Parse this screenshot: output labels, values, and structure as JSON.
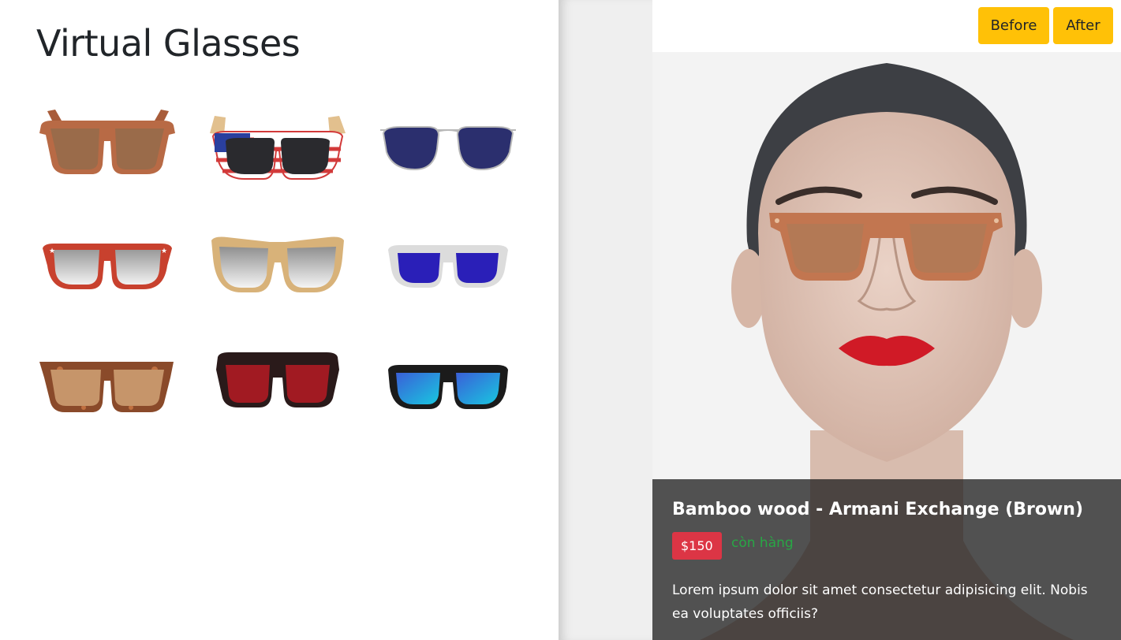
{
  "page": {
    "title": "Virtual Glasses"
  },
  "catalog": {
    "items": [
      {
        "icon": "brown-wood-sunglasses-icon",
        "frame": "#b86a45",
        "lens": "#9a6b4a"
      },
      {
        "icon": "flag-pattern-sunglasses-icon",
        "frame": "#d23a3a",
        "lens": "#2a2a2e"
      },
      {
        "icon": "aviator-sunglasses-icon",
        "frame": "#b8b8b8",
        "lens": "#2b2f6e"
      },
      {
        "icon": "red-star-sunglasses-icon",
        "frame": "#c8412e",
        "lens": "#c9c9c9"
      },
      {
        "icon": "clear-gold-sunglasses-icon",
        "frame": "#d4aa6a",
        "lens": "#cfcfcf"
      },
      {
        "icon": "clear-blue-mirror-sunglasses-icon",
        "frame": "#dcdcdc",
        "lens": "#2a1fb8"
      },
      {
        "icon": "tortoise-sunglasses-icon",
        "frame": "#8a4a2a",
        "lens": "#c6956a"
      },
      {
        "icon": "black-red-sunglasses-icon",
        "frame": "#2a1a1a",
        "lens": "#a11a22"
      },
      {
        "icon": "black-blue-mirror-sunglasses-icon",
        "frame": "#1b1b1b",
        "lens": "#1aa7d8"
      }
    ]
  },
  "toolbar": {
    "before_label": "Before",
    "after_label": "After"
  },
  "product": {
    "name": "Bamboo wood - Armani Exchange (Brown)",
    "price": "$150",
    "stock": "còn hàng",
    "description": "Lorem ipsum dolor sit amet consectetur adipisicing elit. Nobis ea voluptates officiis?"
  },
  "colors": {
    "accent_button": "#ffc107",
    "price_badge": "#dc3545",
    "stock_text": "#28a745"
  }
}
